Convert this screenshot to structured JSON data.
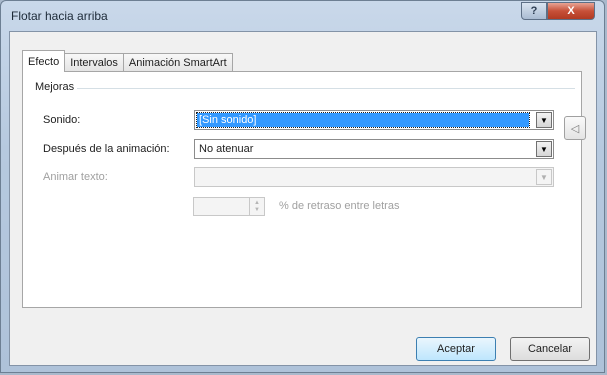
{
  "window": {
    "title": "Flotar hacia arriba",
    "help_glyph": "?",
    "close_glyph": "X"
  },
  "tabs": [
    {
      "label": "Efecto",
      "active": true
    },
    {
      "label": "Intervalos",
      "active": false
    },
    {
      "label": "Animación SmartArt",
      "active": false
    }
  ],
  "group": {
    "label": "Mejoras"
  },
  "fields": {
    "sound": {
      "label": "Sonido:",
      "value": "[Sin sonido]"
    },
    "after_animation": {
      "label": "Después de la animación:",
      "value": "No atenuar"
    },
    "animate_text": {
      "label": "Animar texto:",
      "value": ""
    },
    "delay": {
      "value": "",
      "label": "% de retraso entre letras"
    }
  },
  "icons": {
    "dropdown_arrow": "▼",
    "speaker": "🔈"
  },
  "buttons": {
    "ok": "Aceptar",
    "cancel": "Cancelar"
  }
}
